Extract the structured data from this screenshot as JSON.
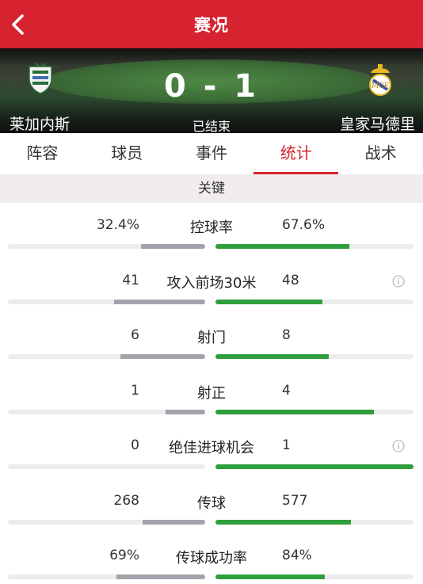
{
  "header": {
    "title": "赛况"
  },
  "match": {
    "home_team": "莱加内斯",
    "away_team": "皇家马德里",
    "score": "0 - 1",
    "status": "已结束"
  },
  "tabs": [
    {
      "label": "阵容",
      "active": false
    },
    {
      "label": "球员",
      "active": false
    },
    {
      "label": "事件",
      "active": false
    },
    {
      "label": "统计",
      "active": true
    },
    {
      "label": "战术",
      "active": false
    }
  ],
  "section_title": "关键",
  "stats": [
    {
      "label": "控球率",
      "left": "32.4%",
      "right": "67.6%",
      "left_share": 0.324,
      "right_share": 0.676,
      "info": false
    },
    {
      "label": "攻入前场30米",
      "left": "41",
      "right": "48",
      "left_share": 0.46,
      "right_share": 0.54,
      "info": true
    },
    {
      "label": "射门",
      "left": "6",
      "right": "8",
      "left_share": 0.43,
      "right_share": 0.57,
      "info": false
    },
    {
      "label": "射正",
      "left": "1",
      "right": "4",
      "left_share": 0.2,
      "right_share": 0.8,
      "info": false
    },
    {
      "label": "绝佳进球机会",
      "left": "0",
      "right": "1",
      "left_share": 0.0,
      "right_share": 1.0,
      "info": true
    },
    {
      "label": "传球",
      "left": "268",
      "right": "577",
      "left_share": 0.317,
      "right_share": 0.683,
      "info": false
    },
    {
      "label": "传球成功率",
      "left": "69%",
      "right": "84%",
      "left_share": 0.45,
      "right_share": 0.55,
      "info": false
    }
  ],
  "colors": {
    "brand": "#d6232f",
    "away_bar": "#2f9e3d",
    "home_bar": "#a3a3ab"
  }
}
